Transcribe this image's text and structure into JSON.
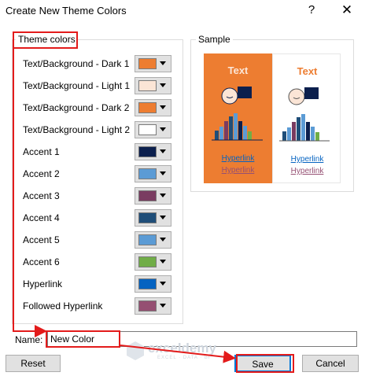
{
  "window": {
    "title": "Create New Theme Colors",
    "help_icon": "?",
    "close_icon": "✕"
  },
  "theme_colors": {
    "label": "Theme colors",
    "rows": [
      {
        "label": "Text/Background - Dark 1",
        "color": "#ed7d31"
      },
      {
        "label": "Text/Background - Light 1",
        "color": "#fbe5d6"
      },
      {
        "label": "Text/Background - Dark 2",
        "color": "#ed7d31"
      },
      {
        "label": "Text/Background - Light 2",
        "color": "#ffffff"
      },
      {
        "label": "Accent 1",
        "color": "#0b1f4d"
      },
      {
        "label": "Accent 2",
        "color": "#5b9bd5"
      },
      {
        "label": "Accent 3",
        "color": "#7a3c61"
      },
      {
        "label": "Accent 4",
        "color": "#1f4e79"
      },
      {
        "label": "Accent 5",
        "color": "#5b9bd5"
      },
      {
        "label": "Accent 6",
        "color": "#70ad47"
      },
      {
        "label": "Hyperlink",
        "color": "#0563c1"
      },
      {
        "label": "Followed Hyperlink",
        "color": "#954f72"
      }
    ]
  },
  "sample": {
    "label": "Sample",
    "dark_text": "Text",
    "light_text": "Text",
    "hyperlink": "Hyperlink",
    "followed_hyperlink": "Hyperlink",
    "dark_bg": "#ed7d31",
    "dark_fg": "#fbe5d6",
    "light_bg": "#ffffff",
    "light_fg": "#ed7d31",
    "hyperlink_color": "#0563c1",
    "followed_color": "#954f72"
  },
  "name": {
    "label": "Name:",
    "value": "New Color"
  },
  "buttons": {
    "reset": "Reset",
    "save": "Save",
    "cancel": "Cancel"
  },
  "watermark": {
    "text": "exceldemy",
    "subtitle": "EXCEL · DATA · BI"
  },
  "annotation_color": "#e31b1b"
}
